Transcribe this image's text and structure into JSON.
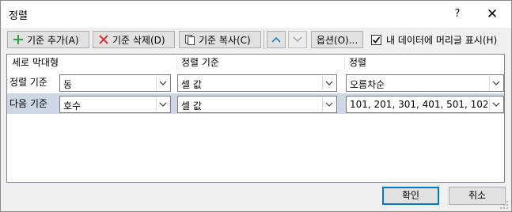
{
  "window": {
    "title": "정렬",
    "help_label": "?",
    "close_label": "✕"
  },
  "toolbar": {
    "add_label": "기준 추가(A)",
    "delete_label": "기준 삭제(D)",
    "copy_label": "기준 복사(C)",
    "options_label": "옵션(O)...",
    "has_headers_label": "내 데이터에 머리글 표시(H)",
    "has_headers_checked": true
  },
  "columns": {
    "column": "세로 막대형",
    "sort_on": "정렬 기준",
    "order": "정렬"
  },
  "rows": [
    {
      "label": "정렬 기준",
      "column": "동",
      "sort_on": "셀 값",
      "order": "오름차순",
      "selected": false
    },
    {
      "label": "다음 기준",
      "column": "호수",
      "sort_on": "셀 값",
      "order": "101, 201, 301, 401, 501, 102, 202",
      "selected": true
    }
  ],
  "footer": {
    "ok_label": "확인",
    "cancel_label": "취소"
  },
  "colors": {
    "accent": "#0078d7",
    "add_icon": "#2e9e3e",
    "delete_icon": "#d13438",
    "selected_row": "#cfd6e5"
  }
}
